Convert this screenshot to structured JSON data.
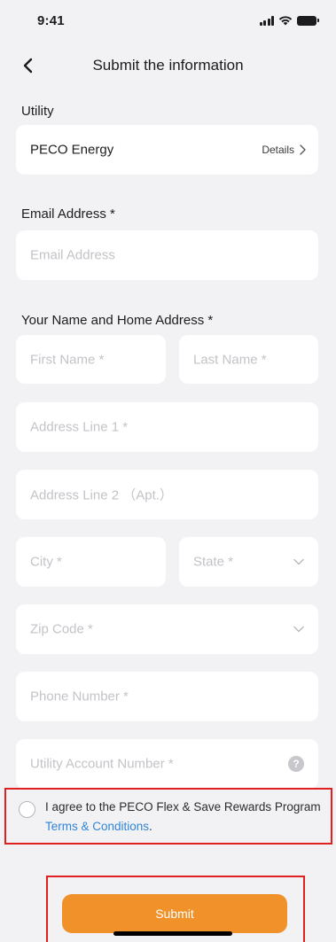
{
  "status_bar": {
    "time": "9:41"
  },
  "nav": {
    "title": "Submit the information"
  },
  "utility": {
    "section_label": "Utility",
    "name": "PECO Energy",
    "details_label": "Details"
  },
  "email": {
    "section_label": "Email Address *",
    "placeholder": "Email Address"
  },
  "address": {
    "section_label": "Your  Name and Home Address *",
    "first_name_placeholder": "First Name *",
    "last_name_placeholder": "Last Name *",
    "address_line1_placeholder": "Address Line 1 *",
    "address_line2_placeholder": "Address Line 2 （Apt.）",
    "city_placeholder": "City *",
    "state_placeholder": "State *",
    "zip_placeholder": "Zip Code *",
    "phone_placeholder": "Phone Number *",
    "account_placeholder": "Utility Account Number *",
    "help_glyph": "?"
  },
  "agreement": {
    "text_prefix": "I agree to the PECO Flex & Save Rewards Program ",
    "link_text": "Terms & Conditions",
    "text_suffix": "."
  },
  "submit": {
    "label": "Submit"
  },
  "colors": {
    "accent": "#f0912a",
    "link": "#2f86d6",
    "highlight": "#e02020",
    "background": "#f2f2f4"
  }
}
